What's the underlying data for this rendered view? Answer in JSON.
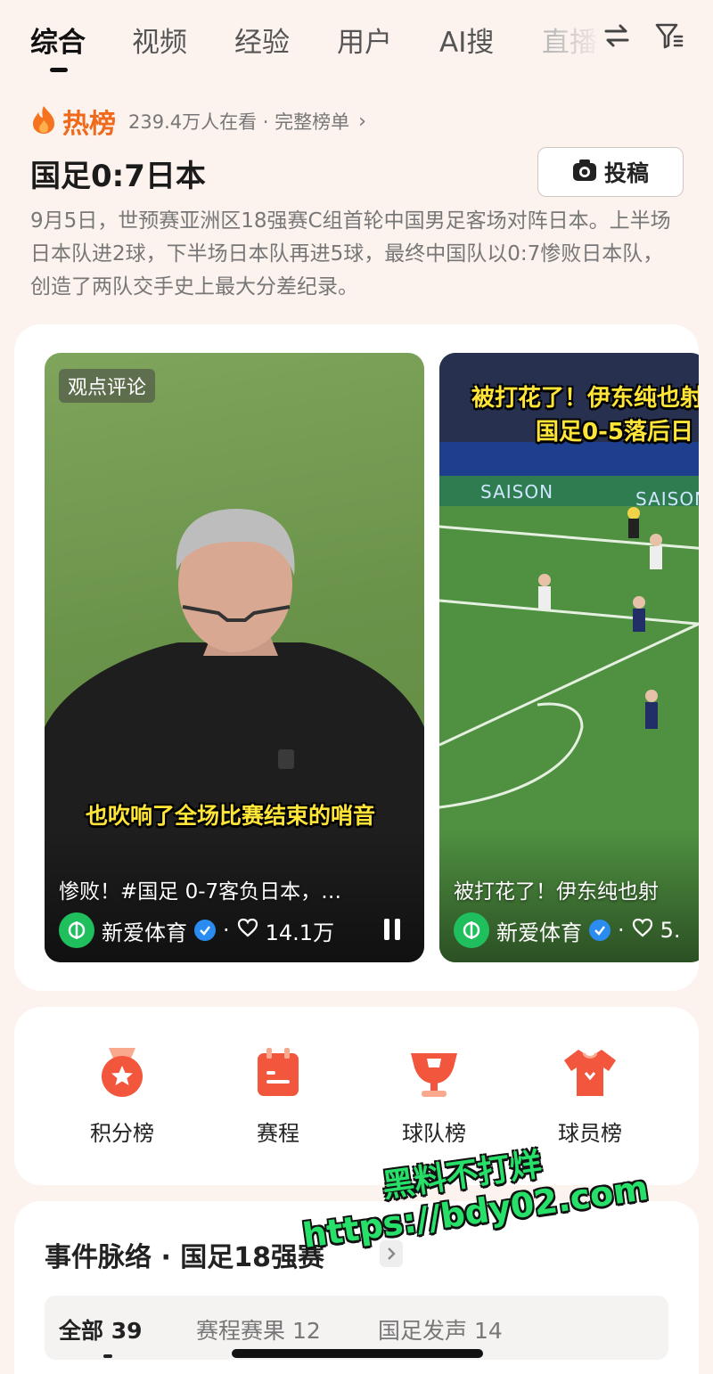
{
  "tabs": [
    {
      "label": "综合",
      "active": true
    },
    {
      "label": "视频"
    },
    {
      "label": "经验"
    },
    {
      "label": "用户"
    },
    {
      "label": "AI搜"
    },
    {
      "label": "直播"
    }
  ],
  "icons": {
    "swap": "swap-icon",
    "filter": "filter-icon"
  },
  "hot": {
    "title": "热榜",
    "meta": "239.4万人在看 · 完整榜单",
    "arrow": "›"
  },
  "topic": {
    "title": "国足0:7日本",
    "post_label": "投稿",
    "description": "9月5日，世预赛亚洲区18强赛C组首轮中国男足客场对阵日本。上半场日本队进2球，下半场日本队再进5球，最终中国队以0:7惨败日本队，创造了两队交手史上最大分差纪录。"
  },
  "videos": [
    {
      "tag": "观点评论",
      "subtitle": "也吹响了全场比赛结束的哨音",
      "caption": "惨败！#国足 0-7客负日本，…",
      "author": "新爱体育",
      "likes": "14.1万"
    },
    {
      "overlay_line1": "被打花了！伊东纯也射",
      "overlay_line2": "国足0-5落后日",
      "ad_text": "SAISON",
      "caption": "被打花了！伊东纯也射",
      "author": "新爱体育",
      "likes": "5."
    }
  ],
  "quick_entries": [
    {
      "label": "积分榜",
      "icon": "medal-icon"
    },
    {
      "label": "赛程",
      "icon": "schedule-icon"
    },
    {
      "label": "球队榜",
      "icon": "trophy-icon"
    },
    {
      "label": "球员榜",
      "icon": "jersey-icon"
    }
  ],
  "events": {
    "title": "事件脉络 · 国足18强赛",
    "tabs": [
      {
        "label": "全部 39",
        "active": true
      },
      {
        "label": "赛程赛果 12"
      },
      {
        "label": "国足发声 14"
      }
    ]
  },
  "watermark": {
    "line1": "黑料不打烊",
    "line2": "https://bdy02.com"
  },
  "colors": {
    "accent": "#f06a1e",
    "background": "#fdf3ee",
    "verified": "#2a8cf0",
    "brand_green": "#1fbf5e"
  }
}
